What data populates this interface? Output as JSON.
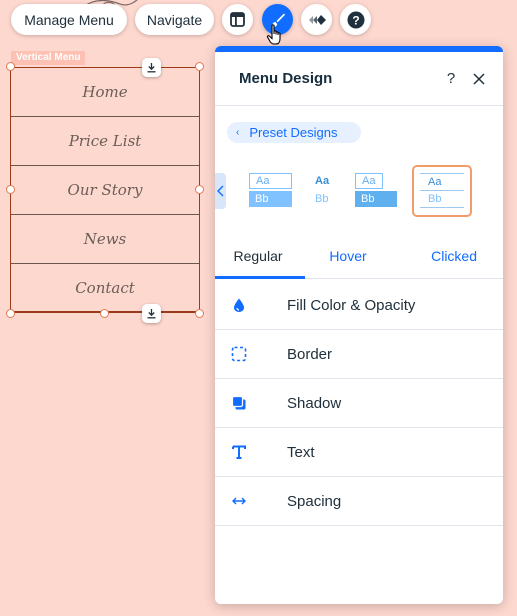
{
  "toolbar": {
    "manage_menu_label": "Manage Menu",
    "navigate_label": "Navigate"
  },
  "element": {
    "tag_label": "Vertical Menu",
    "items": [
      {
        "label": "Home"
      },
      {
        "label": "Price List"
      },
      {
        "label": "Our Story"
      },
      {
        "label": "News"
      },
      {
        "label": "Contact"
      }
    ]
  },
  "panel": {
    "title": "Menu Design",
    "help_label": "?",
    "preset_link": "Preset Designs",
    "presets": [
      {
        "top": "Aa",
        "bottom": "Bb"
      },
      {
        "top": "Aa",
        "bottom": "Bb"
      },
      {
        "top": "Aa",
        "bottom": "Bb"
      },
      {
        "top": "Aa",
        "bottom": "Bb"
      }
    ],
    "tabs": [
      {
        "label": "Regular"
      },
      {
        "label": "Hover"
      },
      {
        "label": "Clicked"
      }
    ],
    "options": [
      {
        "label": "Fill Color & Opacity",
        "icon": "droplet-icon"
      },
      {
        "label": "Border",
        "icon": "dashed-square-icon"
      },
      {
        "label": "Shadow",
        "icon": "shadow-icon"
      },
      {
        "label": "Text",
        "icon": "text-icon"
      },
      {
        "label": "Spacing",
        "icon": "spacing-icon"
      }
    ]
  },
  "colors": {
    "canvas_bg": "#fdd8cf",
    "accent": "#116dff",
    "selection": "#9c3a1c",
    "preset_selected": "#f39c6b"
  }
}
